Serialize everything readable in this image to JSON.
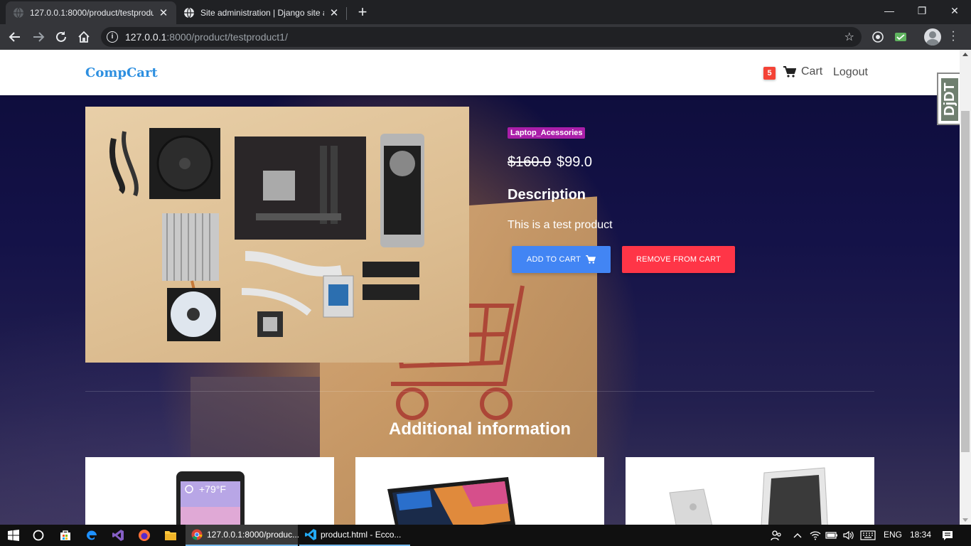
{
  "browser": {
    "tabs": [
      {
        "title": "127.0.0.1:8000/product/testproduct1/",
        "active": true
      },
      {
        "title": "Site administration | Django site admin",
        "active": false
      }
    ],
    "new_tab_label": "+",
    "window_controls": {
      "minimize": "—",
      "restore": "❐",
      "close": "✕"
    },
    "url": {
      "host": "127.0.0.1",
      "rest": ":8000/product/testproduct1/"
    }
  },
  "site": {
    "brand": "CompCart",
    "cart_count": "5",
    "cart_label": "Cart",
    "logout_label": "Logout",
    "debug_toolbar_label": "DjDT"
  },
  "product": {
    "category": "Laptop_Acessories",
    "old_price": "$160.0",
    "price": "$99.0",
    "description_heading": "Description",
    "description": "This is a test product",
    "add_to_cart_label": "ADD TO CART",
    "remove_from_cart_label": "REMOVE FROM CART"
  },
  "additional": {
    "heading": "Additional information",
    "phone_temp": "+79°F"
  },
  "taskbar": {
    "apps": [
      {
        "label": "127.0.0.1:8000/produc...",
        "icon": "chrome-icon"
      },
      {
        "label": "product.html - Ecco...",
        "icon": "vscode-icon"
      }
    ],
    "language": "ENG",
    "time": "18:34"
  },
  "colors": {
    "brand": "#2d8fe0",
    "badge_red": "#f44336",
    "category_purple": "#aa1ea9",
    "add_blue": "#4285f4",
    "remove_red": "#ff3547"
  }
}
